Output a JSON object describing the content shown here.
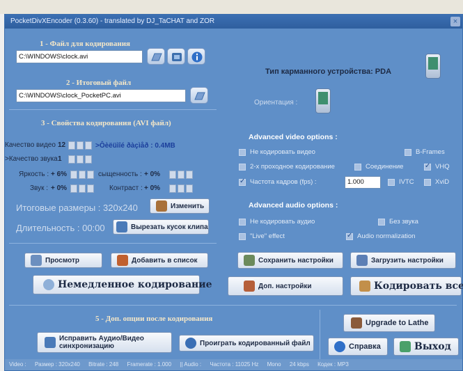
{
  "window": {
    "title": "PocketDivXEncoder (0.3.60) - translated by DJ_TaCHAT and ZOR",
    "close": "×"
  },
  "section1": {
    "title": "1 - Файл для кодирования",
    "input_value": "C:\\WINDOWS\\clock.avi"
  },
  "section2": {
    "title": "2 - Итоговый файл",
    "output_value": "C:\\WINDOWS\\clock_PocketPC.avi"
  },
  "section3": {
    "title": "3 - Свойства кодирования (AVI файл)",
    "video_quality_label": "Качество видео",
    "video_quality_value": "12",
    "bitrate_text": ">Ôèëüìîé ðàçìåð : 0.4MB",
    "audio_quality_label": ">Качество звука",
    "audio_quality_value": "1",
    "brightness_label": "Яркость :",
    "brightness_value": "+ 6%",
    "saturation_label": "сыщенность :",
    "saturation_value": "+ 0%",
    "sound_label": "Звук :",
    "sound_value": "+ 0%",
    "contrast_label": "Контраст :",
    "contrast_value": "+ 0%",
    "final_size_label": "Итоговые размеры : 320x240",
    "change_button": "Изменить",
    "duration_label": "Длительность : 00:00",
    "cut_button": "Вырезать кусок клипа"
  },
  "device": {
    "type_label": "Тип карманного устройства: PDA",
    "orientation_label": "Ориентация :"
  },
  "video_options": {
    "title": "Advanced video options :",
    "no_video": "Не кодировать видео",
    "bframes": "B-Frames",
    "two_pass": "2-х проходное кодирование",
    "join": "Соединение",
    "vhq": "VHQ",
    "framerate": "Частота кадров (fps) :",
    "framerate_value": "1.000",
    "ivtc": "IVTC",
    "xvid": "XviD"
  },
  "audio_options": {
    "title": "Advanced audio options :",
    "no_audio": "Не кодировать аудио",
    "no_sound": "Без звука",
    "live": "\"Live\" effect",
    "normalization": "Audio normalization"
  },
  "buttons": {
    "preview": "Просмотр",
    "add_to_list": "Добавить в список",
    "encode_now": "Немедленное кодирование",
    "save_settings": "Сохранить настройки",
    "load_settings": "Загрузить настройки",
    "extra_settings": "Доп. настройки",
    "encode_all": "Кодировать все",
    "fix_sync": "Исправить Аудио/Видео синхронизацию",
    "play_encoded": "Проиграть кодированный файл",
    "upgrade": "Upgrade to Lathe",
    "help": "Справка",
    "exit": "Выход"
  },
  "section5": {
    "title": "5 - Доп. опции после кодирования"
  },
  "status": {
    "video": "Video :",
    "size": "Размер : 320x240",
    "bitrate": "Bitrate : 248",
    "framerate": "Framerate : 1.000",
    "audio": "|| Audio :",
    "frequency": "Частота : 11025 Hz",
    "mono": "Mono",
    "kbps": "24 kbps",
    "codec": "Кодек : MP3"
  },
  "colors": {
    "window_bg": "#5f8fc8",
    "title_bar": "#2f5f9f",
    "section_title": "#f5e7c7"
  }
}
